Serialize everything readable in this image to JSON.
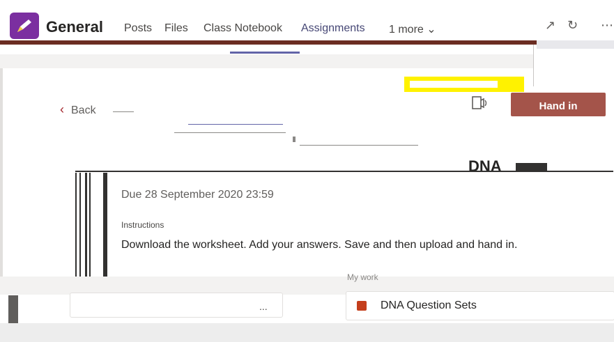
{
  "header": {
    "team_title": "General",
    "tabs": [
      "Posts",
      "Files",
      "Class Notebook",
      "Assignments",
      "1 more"
    ],
    "more_chevron": "⌄",
    "icons": [
      "expand-icon",
      "refresh-icon"
    ]
  },
  "toolbar": {
    "back_label": "Back",
    "hand_in_label": "Hand in",
    "immersive_reader_icon": "immersive-reader-icon"
  },
  "assignment": {
    "title": "DNA",
    "due": "Due 28 September 2020 23:59",
    "instructions_label": "Instructions",
    "instructions_text": "Download the worksheet. Add your answers.  Save and then upload and hand in.",
    "my_work_label": "My work",
    "file_name": "DNA Question Sets",
    "more_label": "..."
  },
  "colors": {
    "accent": "#6264a7",
    "hand_in": "#a4544a",
    "back_chevron": "#a4262c",
    "highlight": "#fff200"
  }
}
